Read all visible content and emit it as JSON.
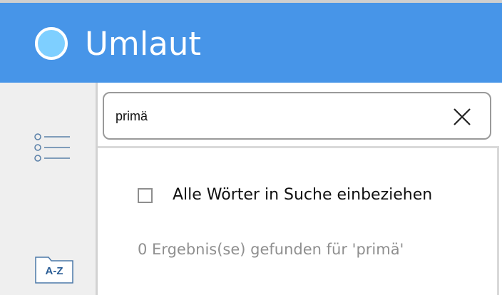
{
  "app": {
    "title": "Umlaut",
    "logo_icon": "circle-logo-icon",
    "header_color": "#4795e8"
  },
  "sidebar": {
    "items": [
      {
        "icon": "list-icon"
      },
      {
        "icon": "az-folder-icon",
        "label": "A-Z"
      }
    ]
  },
  "search": {
    "value": "primä",
    "clear_icon": "close-icon"
  },
  "options": {
    "include_all_words_label": "Alle Wörter in Suche einbeziehen",
    "include_all_words_checked": false
  },
  "results": {
    "text": "0 Ergebnis(se) gefunden für 'primä'"
  }
}
